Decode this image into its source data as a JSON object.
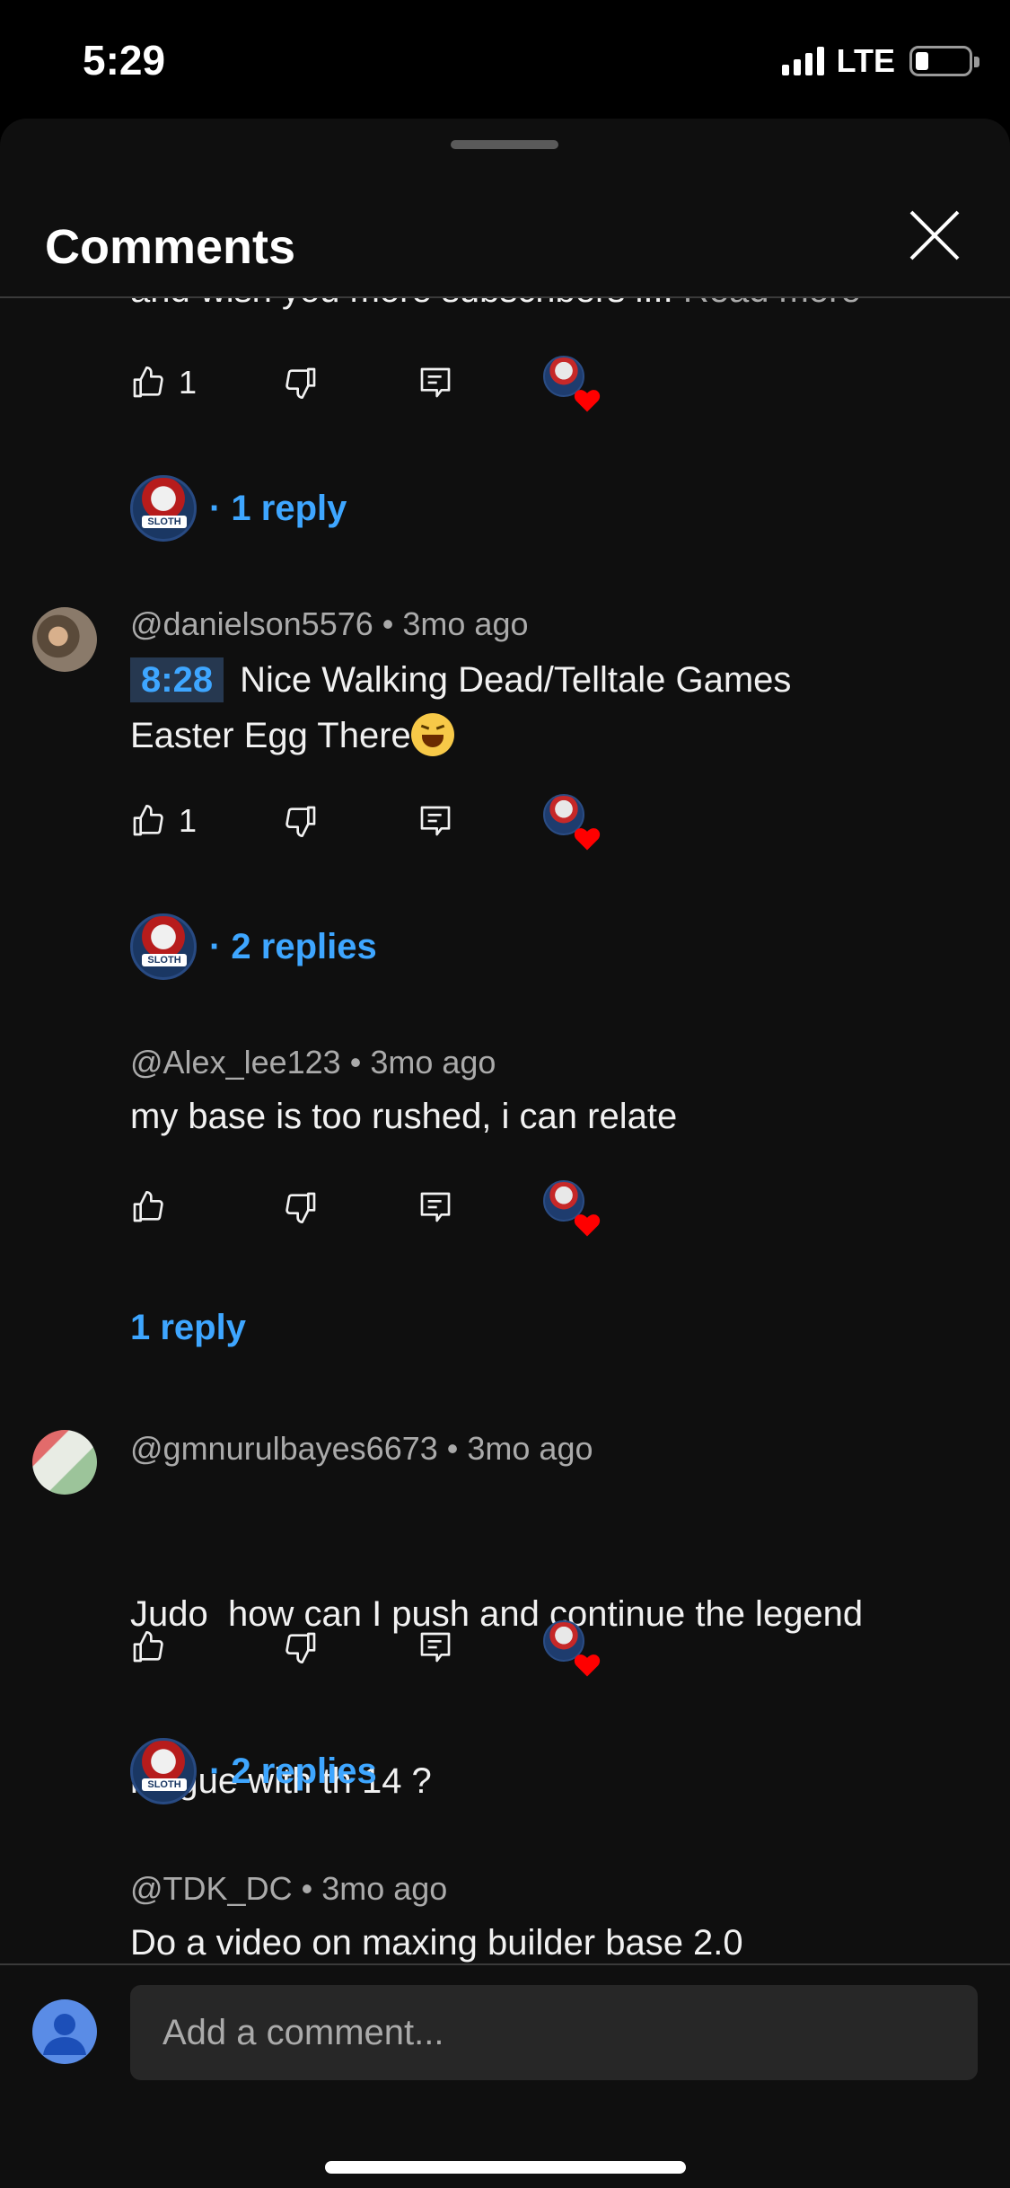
{
  "status": {
    "time": "5:29",
    "network": "LTE"
  },
  "header": {
    "title": "Comments"
  },
  "comments": [
    {
      "text_partial": "and wish you more subscribers i...",
      "read_more": "Read more",
      "likes": "1",
      "replies_label": "· 1 reply"
    },
    {
      "author": "@danielson5576",
      "age": "3mo ago",
      "timestamp": "8:28",
      "text_line1": "Nice Walking Dead/Telltale Games",
      "text_line2": "Easter Egg There",
      "likes": "1",
      "replies_label": "· 2 replies"
    },
    {
      "author": "@Alex_lee123",
      "age": "3mo ago",
      "text": "my base is too rushed, i can relate",
      "replies_label": "1 reply"
    },
    {
      "author": "@gmnurulbayes6673",
      "age": "3mo ago",
      "text_line1": "Judo  how can I push and continue the legend",
      "text_line2": "league with th 14 ?",
      "replies_label": "· 2 replies"
    },
    {
      "author": "@TDK_DC",
      "age": "3mo ago",
      "text": "Do a video on maxing builder base 2.0"
    }
  ],
  "creator_badge_text": "SLOTH",
  "footer": {
    "placeholder": "Add a comment..."
  },
  "colors": {
    "background": "#0f0f0f",
    "link_blue": "#3ea6ff",
    "heart_red": "#ff0000",
    "input_bg": "#272727"
  }
}
